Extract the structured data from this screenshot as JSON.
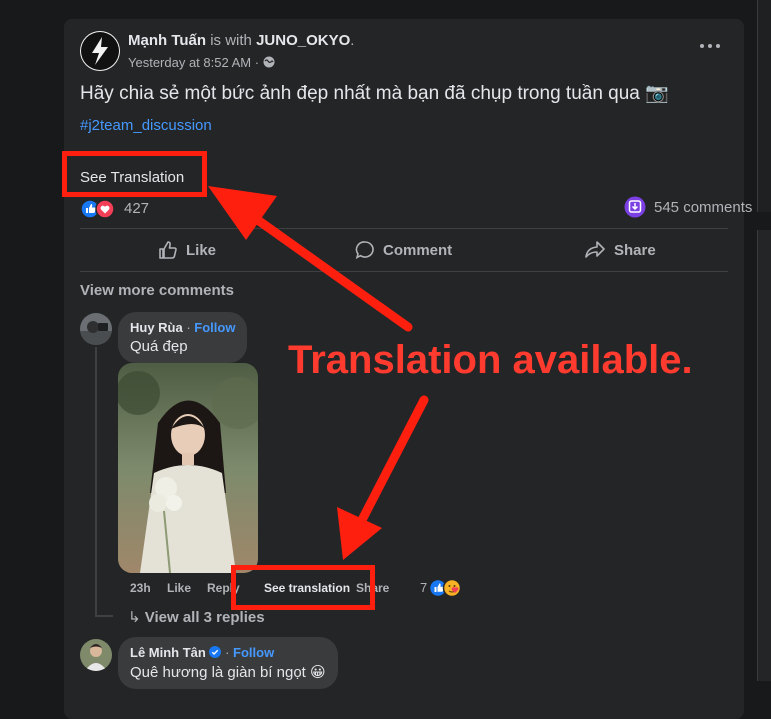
{
  "post": {
    "author": "Mạnh Tuấn",
    "with_text": " is with ",
    "tagged": "JUNO_OKYO",
    "tagged_suffix": ".",
    "time": "Yesterday at 8:52 AM · ",
    "privacy_icon": "globe-icon",
    "text": "Hãy chia sẻ một bức ảnh đẹp nhất mà bạn đã chụp trong tuần qua 📷",
    "hashtag": "#j2team_discussion",
    "see_translation": "See Translation",
    "reaction_count": "427",
    "comments_count": "545 comments"
  },
  "actions": {
    "like": "Like",
    "comment": "Comment",
    "share": "Share"
  },
  "comments_section": {
    "view_more": "View more comments",
    "comment1": {
      "name": "Huy Rùa",
      "follow": "Follow",
      "text": "Quá đẹp",
      "time": "23h",
      "like": "Like",
      "reply": "Reply",
      "see_translation": "See translation",
      "share": "Share",
      "reaction_count": "7"
    },
    "view_replies": "View all 3 replies",
    "comment2": {
      "name": "Lê Minh Tân",
      "follow": "Follow",
      "text": "Quê hương là giàn bí ngọt 😀"
    }
  },
  "annotation": {
    "text": "Translation available."
  },
  "colors": {
    "background": "#18191a",
    "card": "#242526",
    "accent_blue": "#4599ff",
    "annotation_red": "#ff1f0f"
  }
}
